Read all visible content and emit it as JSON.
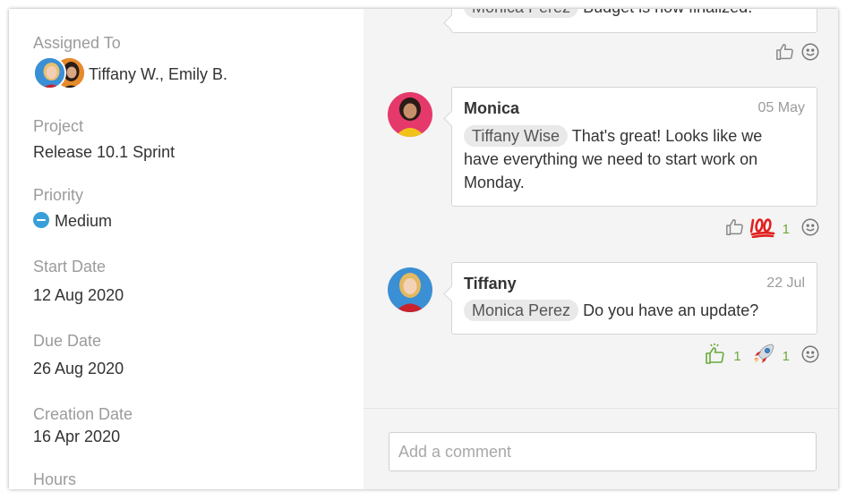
{
  "details": {
    "assigned_label": "Assigned To",
    "assigned_value": "Tiffany W., Emily B.",
    "project_label": "Project",
    "project_value": "Release 10.1 Sprint",
    "priority_label": "Priority",
    "priority_value": "Medium",
    "start_label": "Start Date",
    "start_value": "12 Aug 2020",
    "due_label": "Due Date",
    "due_value": "26 Aug 2020",
    "creation_label": "Creation Date",
    "creation_value": "16 Apr 2020",
    "hours_label": "Hours"
  },
  "comments": [
    {
      "partial_text_mention": "Monica  Perez",
      "partial_text": "Budget is now finalized."
    },
    {
      "author": "Monica",
      "date": "05 May",
      "mention": "Tiffany Wise",
      "text_line1": "That's great! Looks like we",
      "text_line2": "have everything we need to start work on",
      "text_line3": "Monday.",
      "reaction_100_count": "1"
    },
    {
      "author": "Tiffany",
      "date": "22 Jul",
      "mention": "Monica  Perez",
      "text": "Do you have an update?",
      "reaction_like_count": "1",
      "reaction_rocket_count": "1"
    }
  ],
  "composer": {
    "placeholder": "Add a comment"
  },
  "colors": {
    "priority": "#3a9fd8",
    "reaction_count": "#6aaa3a",
    "panel_bg": "#f4f4f4"
  },
  "icons": {
    "like": "thumbs-up-icon",
    "emoji": "smiley-icon",
    "hundred": "hundred-points-icon",
    "rocket": "rocket-icon",
    "priority": "minus-circle-icon"
  }
}
